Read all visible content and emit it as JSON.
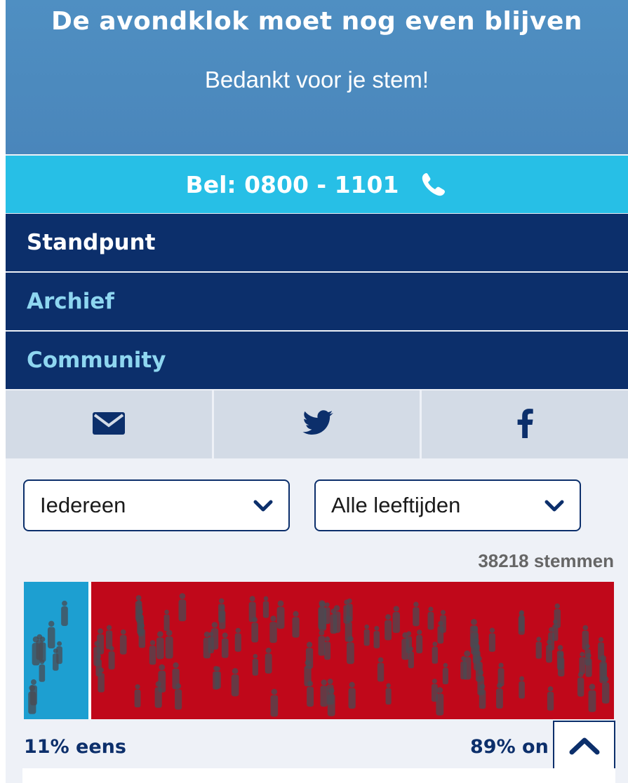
{
  "header": {
    "title": "De avondklok moet nog even blijven",
    "message": "Bedankt voor je stem!"
  },
  "callbar": {
    "label": "Bel: 0800 - 1101",
    "icon": "phone-icon"
  },
  "nav": {
    "items": [
      {
        "label": "Standpunt"
      },
      {
        "label": "Archief"
      },
      {
        "label": "Community"
      }
    ]
  },
  "share": {
    "items": [
      {
        "icon": "mail-icon"
      },
      {
        "icon": "twitter-icon"
      },
      {
        "icon": "facebook-icon"
      }
    ]
  },
  "filters": {
    "group": {
      "value": "Iedereen"
    },
    "age": {
      "value": "Alle leeftijden"
    }
  },
  "results": {
    "votes_label": "38218 stemmen",
    "agree_percent": 11,
    "disagree_percent": 89,
    "agree_label": "11% eens",
    "disagree_label": "89% on",
    "colors": {
      "agree": "#1d9fd1",
      "disagree": "#c0081a",
      "figures": "#4a4a52"
    }
  },
  "colors": {
    "header": "#4f8fc2",
    "callbar": "#27bfe6",
    "nav": "#0c2f6b",
    "share": "#d3dbe6"
  }
}
